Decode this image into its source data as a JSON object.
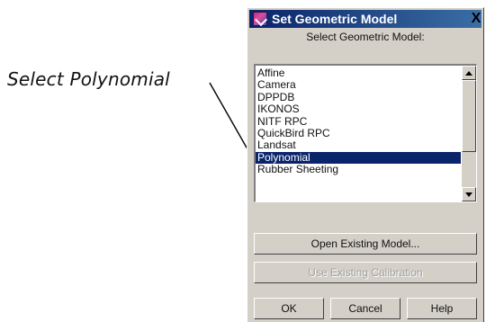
{
  "callout": {
    "text": "Select Polynomial"
  },
  "dialog": {
    "title": "Set Geometric Model",
    "close_label": "X",
    "subtitle": "Select Geometric Model:",
    "models": [
      "Affine",
      "Camera",
      "DPPDB",
      "IKONOS",
      "NITF RPC",
      "QuickBird RPC",
      "Landsat",
      "Polynomial",
      "Rubber Sheeting"
    ],
    "selected_model": "Polynomial",
    "buttons": {
      "open_existing": "Open Existing Model...",
      "use_existing": "Use Existing Calibration",
      "ok": "OK",
      "cancel": "Cancel",
      "help": "Help"
    }
  },
  "colors": {
    "selection": "#0a246a",
    "titlebar": "#0a246a",
    "dialog_bg": "#d4d0c8"
  }
}
